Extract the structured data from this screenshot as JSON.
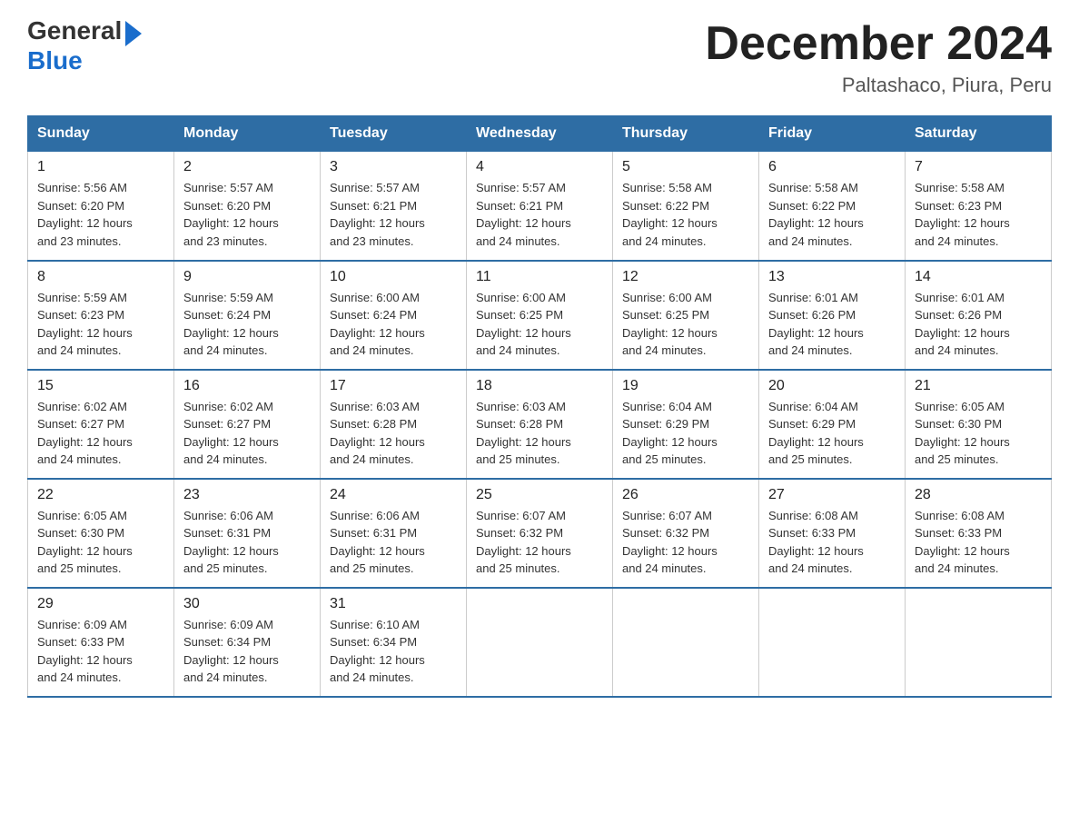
{
  "logo": {
    "general": "General",
    "blue": "Blue",
    "arrow": "▶"
  },
  "title": "December 2024",
  "subtitle": "Paltashaco, Piura, Peru",
  "headers": [
    "Sunday",
    "Monday",
    "Tuesday",
    "Wednesday",
    "Thursday",
    "Friday",
    "Saturday"
  ],
  "weeks": [
    [
      {
        "day": "1",
        "sunrise": "5:56 AM",
        "sunset": "6:20 PM",
        "daylight": "12 hours and 23 minutes."
      },
      {
        "day": "2",
        "sunrise": "5:57 AM",
        "sunset": "6:20 PM",
        "daylight": "12 hours and 23 minutes."
      },
      {
        "day": "3",
        "sunrise": "5:57 AM",
        "sunset": "6:21 PM",
        "daylight": "12 hours and 23 minutes."
      },
      {
        "day": "4",
        "sunrise": "5:57 AM",
        "sunset": "6:21 PM",
        "daylight": "12 hours and 24 minutes."
      },
      {
        "day": "5",
        "sunrise": "5:58 AM",
        "sunset": "6:22 PM",
        "daylight": "12 hours and 24 minutes."
      },
      {
        "day": "6",
        "sunrise": "5:58 AM",
        "sunset": "6:22 PM",
        "daylight": "12 hours and 24 minutes."
      },
      {
        "day": "7",
        "sunrise": "5:58 AM",
        "sunset": "6:23 PM",
        "daylight": "12 hours and 24 minutes."
      }
    ],
    [
      {
        "day": "8",
        "sunrise": "5:59 AM",
        "sunset": "6:23 PM",
        "daylight": "12 hours and 24 minutes."
      },
      {
        "day": "9",
        "sunrise": "5:59 AM",
        "sunset": "6:24 PM",
        "daylight": "12 hours and 24 minutes."
      },
      {
        "day": "10",
        "sunrise": "6:00 AM",
        "sunset": "6:24 PM",
        "daylight": "12 hours and 24 minutes."
      },
      {
        "day": "11",
        "sunrise": "6:00 AM",
        "sunset": "6:25 PM",
        "daylight": "12 hours and 24 minutes."
      },
      {
        "day": "12",
        "sunrise": "6:00 AM",
        "sunset": "6:25 PM",
        "daylight": "12 hours and 24 minutes."
      },
      {
        "day": "13",
        "sunrise": "6:01 AM",
        "sunset": "6:26 PM",
        "daylight": "12 hours and 24 minutes."
      },
      {
        "day": "14",
        "sunrise": "6:01 AM",
        "sunset": "6:26 PM",
        "daylight": "12 hours and 24 minutes."
      }
    ],
    [
      {
        "day": "15",
        "sunrise": "6:02 AM",
        "sunset": "6:27 PM",
        "daylight": "12 hours and 24 minutes."
      },
      {
        "day": "16",
        "sunrise": "6:02 AM",
        "sunset": "6:27 PM",
        "daylight": "12 hours and 24 minutes."
      },
      {
        "day": "17",
        "sunrise": "6:03 AM",
        "sunset": "6:28 PM",
        "daylight": "12 hours and 24 minutes."
      },
      {
        "day": "18",
        "sunrise": "6:03 AM",
        "sunset": "6:28 PM",
        "daylight": "12 hours and 25 minutes."
      },
      {
        "day": "19",
        "sunrise": "6:04 AM",
        "sunset": "6:29 PM",
        "daylight": "12 hours and 25 minutes."
      },
      {
        "day": "20",
        "sunrise": "6:04 AM",
        "sunset": "6:29 PM",
        "daylight": "12 hours and 25 minutes."
      },
      {
        "day": "21",
        "sunrise": "6:05 AM",
        "sunset": "6:30 PM",
        "daylight": "12 hours and 25 minutes."
      }
    ],
    [
      {
        "day": "22",
        "sunrise": "6:05 AM",
        "sunset": "6:30 PM",
        "daylight": "12 hours and 25 minutes."
      },
      {
        "day": "23",
        "sunrise": "6:06 AM",
        "sunset": "6:31 PM",
        "daylight": "12 hours and 25 minutes."
      },
      {
        "day": "24",
        "sunrise": "6:06 AM",
        "sunset": "6:31 PM",
        "daylight": "12 hours and 25 minutes."
      },
      {
        "day": "25",
        "sunrise": "6:07 AM",
        "sunset": "6:32 PM",
        "daylight": "12 hours and 25 minutes."
      },
      {
        "day": "26",
        "sunrise": "6:07 AM",
        "sunset": "6:32 PM",
        "daylight": "12 hours and 24 minutes."
      },
      {
        "day": "27",
        "sunrise": "6:08 AM",
        "sunset": "6:33 PM",
        "daylight": "12 hours and 24 minutes."
      },
      {
        "day": "28",
        "sunrise": "6:08 AM",
        "sunset": "6:33 PM",
        "daylight": "12 hours and 24 minutes."
      }
    ],
    [
      {
        "day": "29",
        "sunrise": "6:09 AM",
        "sunset": "6:33 PM",
        "daylight": "12 hours and 24 minutes."
      },
      {
        "day": "30",
        "sunrise": "6:09 AM",
        "sunset": "6:34 PM",
        "daylight": "12 hours and 24 minutes."
      },
      {
        "day": "31",
        "sunrise": "6:10 AM",
        "sunset": "6:34 PM",
        "daylight": "12 hours and 24 minutes."
      },
      null,
      null,
      null,
      null
    ]
  ],
  "labels": {
    "sunrise": "Sunrise: ",
    "sunset": "Sunset: ",
    "daylight": "Daylight: "
  }
}
